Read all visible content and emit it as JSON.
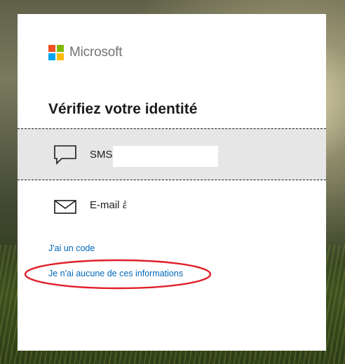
{
  "brand": {
    "name": "Microsoft",
    "logo_colors": [
      "#f25022",
      "#7fba00",
      "#00a4ef",
      "#ffb900"
    ]
  },
  "page": {
    "title": "Vérifiez votre identité"
  },
  "options": [
    {
      "label": "SMS",
      "icon": "chat-bubble-icon",
      "selected": true
    },
    {
      "label": "E-mail à",
      "icon": "envelope-icon",
      "selected": false
    }
  ],
  "links": {
    "have_code": "J'ai un code",
    "no_info": "Je n'ai aucune de ces informations"
  },
  "annotation": {
    "color": "#e0202a",
    "icon": "red-ellipse-annotation"
  }
}
